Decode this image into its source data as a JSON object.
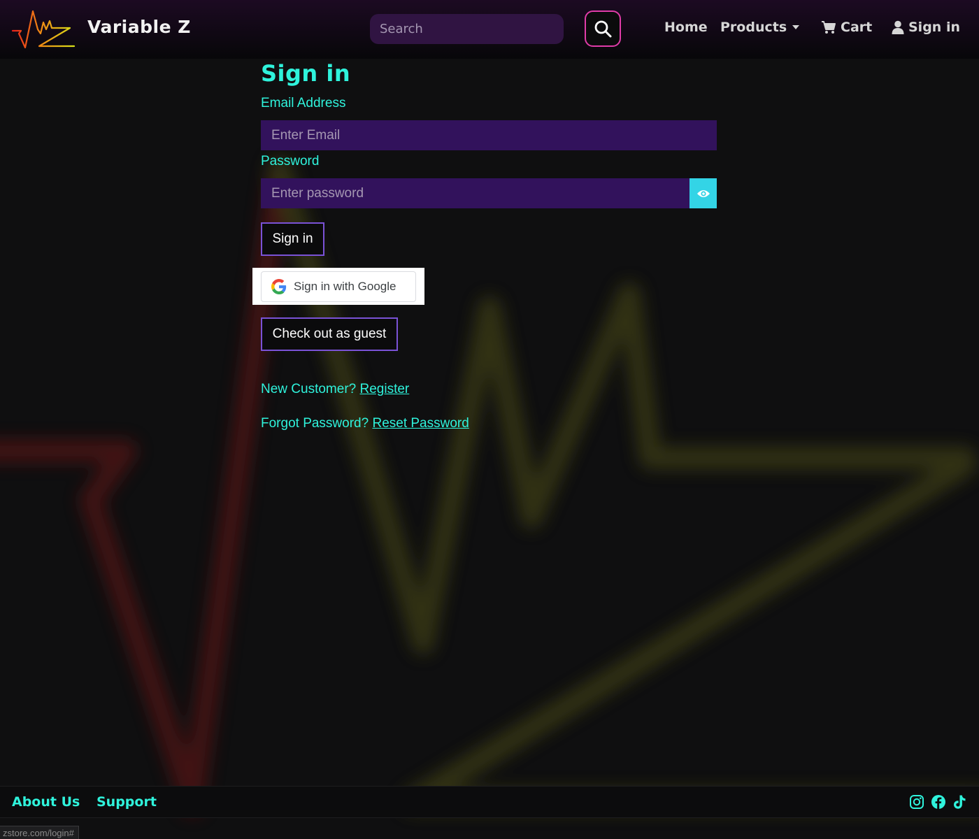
{
  "brand": {
    "name": "Variable Z"
  },
  "search": {
    "placeholder": "Search"
  },
  "nav": {
    "home": "Home",
    "products": "Products",
    "cart": "Cart",
    "signin": "Sign in"
  },
  "form": {
    "title": "Sign in",
    "email_label": "Email Address",
    "email_placeholder": "Enter Email",
    "password_label": "Password",
    "password_placeholder": "Enter password",
    "signin_button": "Sign in",
    "google_button": "Sign in with Google",
    "guest_button": "Check out as guest",
    "new_customer_text": "New Customer?",
    "register_link": "Register",
    "forgot_text": "Forgot Password?",
    "reset_link": "Reset Password"
  },
  "footer": {
    "about": "About Us",
    "support": "Support",
    "social_icons": [
      "instagram-icon",
      "facebook-icon",
      "tiktok-icon"
    ]
  },
  "status_bar": {
    "url": "zstore.com/login#"
  },
  "colors": {
    "accent_cyan": "#2ff3dc",
    "input_purple": "#32125c",
    "button_border": "#7a52d6",
    "search_border": "#e03ca8",
    "eye_button": "#33d4e6"
  }
}
